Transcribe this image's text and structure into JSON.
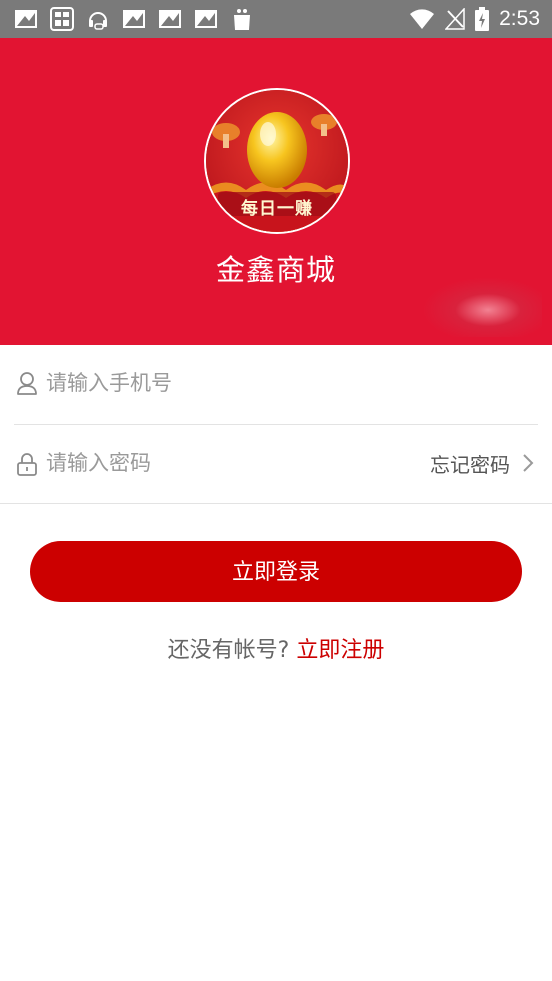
{
  "status_bar": {
    "time": "2:53",
    "icons_left": [
      "image-notification-icon",
      "game-app-icon",
      "headset-icon",
      "image-notification-icon",
      "image-notification-icon",
      "image-notification-icon",
      "shopping-bag-icon"
    ],
    "icons_right": [
      "wifi-icon",
      "no-signal-icon",
      "battery-charging-icon"
    ]
  },
  "header": {
    "logo_text": "每日一赚",
    "app_name": "金鑫商城",
    "background_color": "#e21432"
  },
  "login_form": {
    "phone": {
      "placeholder": "请输入手机号",
      "value": ""
    },
    "password": {
      "placeholder": "请输入密码",
      "value": ""
    },
    "forgot_password": "忘记密码",
    "login_button": "立即登录",
    "no_account_text": "还没有帐号?",
    "register_link": "立即注册"
  },
  "colors": {
    "accent": "#cc0000",
    "status_bar": "#7a7a7a"
  }
}
